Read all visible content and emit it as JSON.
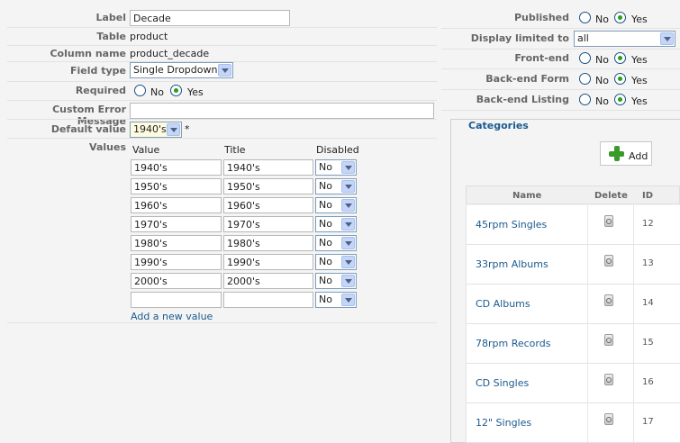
{
  "form": {
    "label": {
      "caption": "Label",
      "value": "Decade"
    },
    "table": {
      "caption": "Table",
      "value": "product"
    },
    "column_name": {
      "caption": "Column name",
      "value": "product_decade"
    },
    "field_type": {
      "caption": "Field type",
      "value": "Single Dropdown"
    },
    "required": {
      "caption": "Required",
      "no": "No",
      "yes": "Yes",
      "selected": "Yes"
    },
    "custom_error": {
      "caption": "Custom Error Message",
      "value": ""
    },
    "default_value": {
      "caption": "Default value",
      "value": "1940's",
      "asterisk": "*"
    },
    "values": {
      "caption": "Values",
      "col_value": "Value",
      "col_title": "Title",
      "col_disabled": "Disabled",
      "rows": [
        {
          "value": "1940's",
          "title": "1940's",
          "disabled": "No"
        },
        {
          "value": "1950's",
          "title": "1950's",
          "disabled": "No"
        },
        {
          "value": "1960's",
          "title": "1960's",
          "disabled": "No"
        },
        {
          "value": "1970's",
          "title": "1970's",
          "disabled": "No"
        },
        {
          "value": "1980's",
          "title": "1980's",
          "disabled": "No"
        },
        {
          "value": "1990's",
          "title": "1990's",
          "disabled": "No"
        },
        {
          "value": "2000's",
          "title": "2000's",
          "disabled": "No"
        },
        {
          "value": "",
          "title": "",
          "disabled": "No"
        }
      ],
      "add_link": "Add a new value"
    }
  },
  "settings": {
    "published": {
      "caption": "Published",
      "no": "No",
      "yes": "Yes",
      "selected": "Yes"
    },
    "display_limited": {
      "caption": "Display limited to",
      "value": "all"
    },
    "front_end": {
      "caption": "Front-end",
      "no": "No",
      "yes": "Yes",
      "selected": "Yes"
    },
    "back_end_form": {
      "caption": "Back-end Form",
      "no": "No",
      "yes": "Yes",
      "selected": "Yes"
    },
    "back_end_listing": {
      "caption": "Back-end Listing",
      "no": "No",
      "yes": "Yes",
      "selected": "Yes"
    }
  },
  "categories": {
    "legend": "Categories",
    "add_label": "Add",
    "headers": {
      "name": "Name",
      "delete": "Delete",
      "id": "ID"
    },
    "rows": [
      {
        "name": "45rpm Singles",
        "id": "12"
      },
      {
        "name": "33rpm Albums",
        "id": "13"
      },
      {
        "name": "CD Albums",
        "id": "14"
      },
      {
        "name": "78rpm Records",
        "id": "15"
      },
      {
        "name": "CD Singles",
        "id": "16"
      },
      {
        "name": "12\" Singles",
        "id": "17"
      }
    ]
  }
}
